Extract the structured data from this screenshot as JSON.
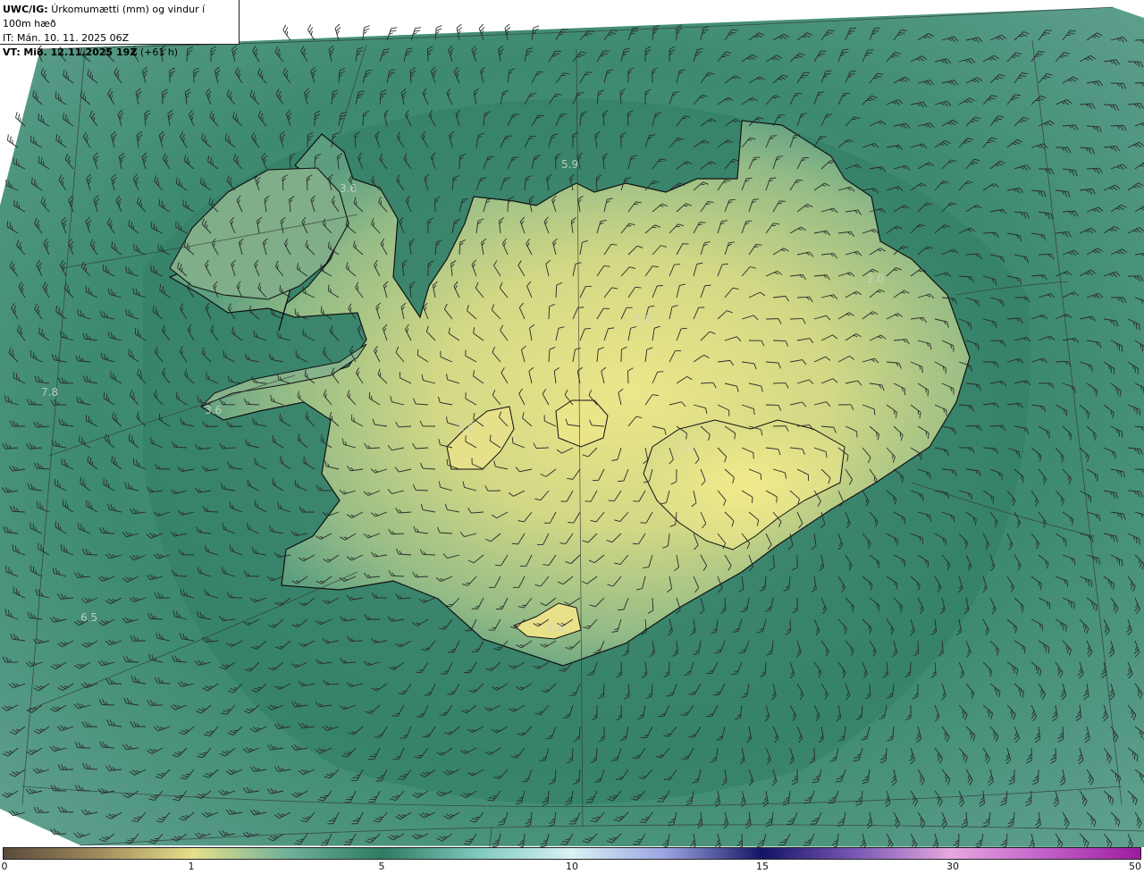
{
  "header": {
    "model": "UWC/IG:",
    "title": "Úrkomumætti (mm) og vindur í 100m hæð",
    "init_label": "IT:",
    "init_time": "Mán. 10. 11. 2025 06Z",
    "valid_label": "VT:",
    "valid_time": "Mið. 12.11.2025 19Z",
    "lead": "(+61 h)"
  },
  "colorbar": {
    "ticks": [
      {
        "label": "0",
        "value": 0
      },
      {
        "label": "1",
        "value": 1
      },
      {
        "label": "5",
        "value": 5
      },
      {
        "label": "10",
        "value": 10
      },
      {
        "label": "15",
        "value": 15
      },
      {
        "label": "30",
        "value": 30
      },
      {
        "label": "50",
        "value": 50
      }
    ],
    "colors": [
      "#5a4a3a",
      "#a08a5c",
      "#e6e08a",
      "#6fb19a",
      "#2e7a62",
      "#7ec9bd",
      "#d8f2f4",
      "#9aa2e0",
      "#141464",
      "#7a58b4",
      "#e6a8e0",
      "#c060c8",
      "#9e1a9e"
    ]
  },
  "map_labels": [
    {
      "text": "5.9",
      "kind": "precip-max"
    },
    {
      "text": "3.6",
      "kind": "precip-max"
    },
    {
      "text": "7.8",
      "kind": "precip-max"
    },
    {
      "text": "3.6",
      "kind": "precip-max"
    },
    {
      "text": "6.5",
      "kind": "precip-max"
    },
    {
      "text": "2.0",
      "kind": "precip-max"
    },
    {
      "text": "2.0",
      "kind": "precip-max"
    },
    {
      "text": "1.0",
      "kind": "precip-max"
    },
    {
      "text": "1.1",
      "kind": "precip-max"
    },
    {
      "text": "1.6",
      "kind": "precip-max"
    }
  ],
  "field_colors": {
    "sea_dark": "#2f7a60",
    "sea_mid": "#3f8a72",
    "sea_light": "#6aaa98",
    "land_low": "#8fb57f",
    "land_high": "#e8e488",
    "coast": "#111111",
    "barb": "#2a2a2a",
    "grid": "#333333"
  }
}
